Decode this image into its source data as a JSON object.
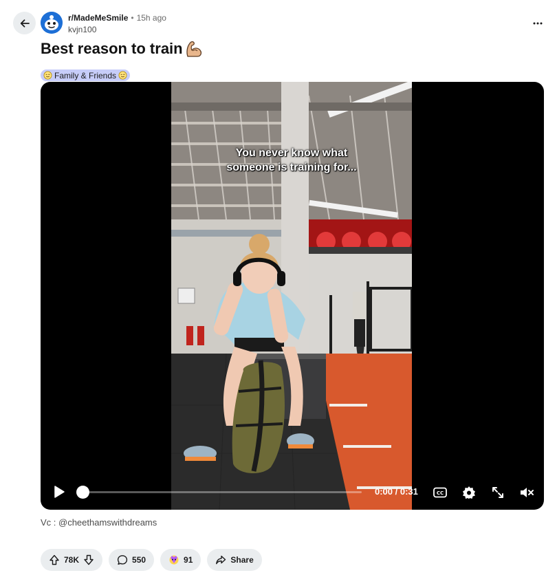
{
  "post": {
    "subreddit": "r/MadeMeSmile",
    "separator": "•",
    "time_ago": "15h ago",
    "author": "kvjn100",
    "title": "Best reason to train",
    "title_emoji": "flexed-biceps-icon",
    "flair": {
      "label": "Family & Friends",
      "emoji": "smiling-face-icon",
      "color": "#c7cdf9"
    }
  },
  "video": {
    "caption": "You never know what\nsomeone is training for...",
    "time": "0:00 / 0:31",
    "progress": 0,
    "controls": [
      "play-icon",
      "captions-icon",
      "settings-icon",
      "fullscreen-icon",
      "mute-icon"
    ]
  },
  "credit": "Vc : @cheethamswithdreams",
  "actions": {
    "votes": "78K",
    "comments": "550",
    "awards": "91",
    "share": "Share"
  },
  "colors": {
    "pill_bg": "#eaedef",
    "accent": "#1d6fd6"
  }
}
